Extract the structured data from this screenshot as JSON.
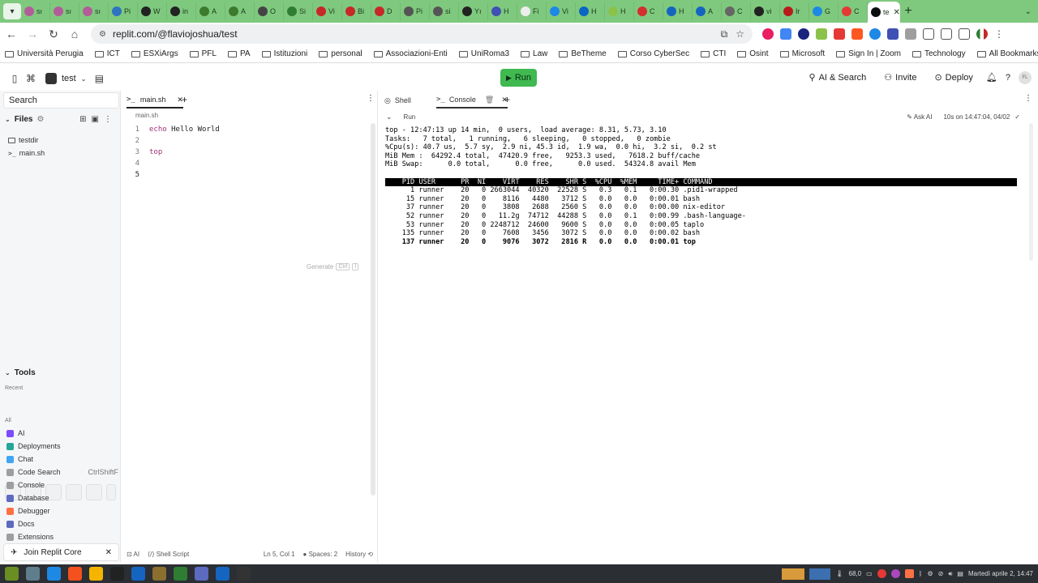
{
  "browser": {
    "tabs": [
      {
        "label": "sı",
        "color": "#b35c9a"
      },
      {
        "label": "sı",
        "color": "#b35c9a"
      },
      {
        "label": "sı",
        "color": "#b35c9a"
      },
      {
        "label": "Pi",
        "color": "#2f74c0"
      },
      {
        "label": "W",
        "color": "#222222"
      },
      {
        "label": "in",
        "color": "#222222"
      },
      {
        "label": "A",
        "color": "#3c7a2e"
      },
      {
        "label": "A",
        "color": "#3c7a2e"
      },
      {
        "label": "O",
        "color": "#444444"
      },
      {
        "label": "Si",
        "color": "#2e7d32"
      },
      {
        "label": "Vi",
        "color": "#c62828"
      },
      {
        "label": "Bi",
        "color": "#c62828"
      },
      {
        "label": "D",
        "color": "#c62828"
      },
      {
        "label": "Pi",
        "color": "#555555"
      },
      {
        "label": "si",
        "color": "#555555"
      },
      {
        "label": "Yı",
        "color": "#222222"
      },
      {
        "label": "H",
        "color": "#3f51b5"
      },
      {
        "label": "Fi",
        "color": "#eeeeee"
      },
      {
        "label": "Vi",
        "color": "#1e88e5"
      },
      {
        "label": "H",
        "color": "#0a66c2"
      },
      {
        "label": "H",
        "color": "#8bc34a"
      },
      {
        "label": "C",
        "color": "#d32f2f"
      },
      {
        "label": "H",
        "color": "#1565c0"
      },
      {
        "label": "A",
        "color": "#1565c0"
      },
      {
        "label": "C",
        "color": "#666666"
      },
      {
        "label": "vi",
        "color": "#222222"
      },
      {
        "label": "Ir",
        "color": "#b71c1c"
      },
      {
        "label": "G",
        "color": "#1e88e5"
      },
      {
        "label": "C",
        "color": "#e53935"
      }
    ],
    "active_tab": {
      "label": "te",
      "color": "#0b0d0e"
    },
    "url": "replit.com/@flaviojoshua/test",
    "bookmarks": [
      "Università Perugia",
      "ICT",
      "ESXiArgs",
      "PFL",
      "PA",
      "Istituzioni",
      "personal",
      "Associazioni-Enti",
      "UniRoma3",
      "Law",
      "BeTheme",
      "Corso CyberSec",
      "CTI",
      "Osint",
      "Microsoft",
      "Sign In | Zoom",
      "Technology"
    ],
    "all_bookmarks": "All Bookmarks"
  },
  "replit": {
    "repl_name": "test",
    "run_label": "Run",
    "ai_search": "AI & Search",
    "invite": "Invite",
    "deploy": "Deploy",
    "avatar_initials": "FL"
  },
  "sidebar": {
    "search_label": "Search",
    "files_title": "Files",
    "files": [
      {
        "name": "testdir",
        "icon": "folder-icon"
      },
      {
        "name": "main.sh",
        "icon": "shell-icon"
      }
    ],
    "tools_title": "Tools",
    "recent_label": "Recent",
    "all_label": "All",
    "tools": [
      {
        "name": "AI",
        "color": "#7c4dff",
        "shortcut": ""
      },
      {
        "name": "Deployments",
        "color": "#26a69a",
        "shortcut": ""
      },
      {
        "name": "Chat",
        "color": "#42a5f5",
        "shortcut": ""
      },
      {
        "name": "Code Search",
        "color": "#9e9e9e",
        "shortcut": "CtrlShiftF"
      },
      {
        "name": "Console",
        "color": "#9e9e9e",
        "shortcut": ""
      },
      {
        "name": "Database",
        "color": "#5c6bc0",
        "shortcut": ""
      },
      {
        "name": "Debugger",
        "color": "#ff7043",
        "shortcut": ""
      },
      {
        "name": "Docs",
        "color": "#5c6bc0",
        "shortcut": ""
      },
      {
        "name": "Extensions",
        "color": "#9e9e9e",
        "shortcut": ""
      }
    ],
    "join_core": "Join Replit Core"
  },
  "editor": {
    "tab_label": "main.sh",
    "breadcrumb": "main.sh",
    "lines": [
      {
        "num": "1",
        "kw": "echo",
        "rest": " Hello World"
      },
      {
        "num": "2",
        "kw": "",
        "rest": ""
      },
      {
        "num": "3",
        "kw": "top",
        "rest": ""
      },
      {
        "num": "4",
        "kw": "",
        "rest": ""
      },
      {
        "num": "5",
        "kw": "",
        "rest": ""
      }
    ],
    "ghost_text": "Generate",
    "ghost_key1": "Ctrl",
    "ghost_key2": "I",
    "status": {
      "ai": "AI",
      "language": "Shell Script",
      "position": "Ln 5, Col 1",
      "spaces": "Spaces: 2",
      "history": "History"
    }
  },
  "console": {
    "shell_tab": "Shell",
    "console_tab": "Console",
    "run_label": "Run",
    "ask_ai": "Ask AI",
    "run_info": "10s on 14:47:04, 04/02",
    "top_lines": [
      "top - 12:47:13 up 14 min,  0 users,  load average: 8.31, 5.73, 3.10",
      "Tasks:   7 total,   1 running,   6 sleeping,   0 stopped,   0 zombie",
      "%Cpu(s): 40.7 us,  5.7 sy,  2.9 ni, 45.3 id,  1.9 wa,  0.0 hi,  3.2 si,  0.2 st",
      "MiB Mem :  64292.4 total,  47420.9 free,   9253.3 used,   7618.2 buff/cache",
      "MiB Swap:      0.0 total,      0.0 free,      0.0 used.  54324.8 avail Mem"
    ],
    "table_header": "    PID USER      PR  NI    VIRT    RES    SHR S  %CPU  %MEM     TIME+ COMMAND",
    "processes": [
      "      1 runner    20   0 2663044  40320  22528 S   0.3   0.1   0:00.30 .pid1-wrapped",
      "     15 runner    20   0    8116   4480   3712 S   0.0   0.0   0:00.01 bash",
      "     37 runner    20   0    3808   2688   2560 S   0.0   0.0   0:00.00 nix-editor",
      "     52 runner    20   0   11.2g  74712  44288 S   0.0   0.1   0:00.99 .bash-language-",
      "     53 runner    20   0 2248712  24600   9600 S   0.0   0.0   0:00.05 taplo",
      "    135 runner    20   0    7608   3456   3072 S   0.0   0.0   0:00.02 bash"
    ],
    "active_process": "    137 runner    20   0    9076   3072   2816 R   0.0   0.0   0:00.01 top"
  },
  "taskbar": {
    "icons": [
      "#6b8e23",
      "#607d8b",
      "#1e88e5",
      "#f4511e",
      "#f4b400",
      "#222222",
      "#1565c0",
      "#8b6f2f",
      "#2e7d32",
      "#5c6bc0",
      "#1565c0",
      "#333333"
    ],
    "temp": "68,0",
    "clock": "Martedì aprile  2, 14:47"
  }
}
